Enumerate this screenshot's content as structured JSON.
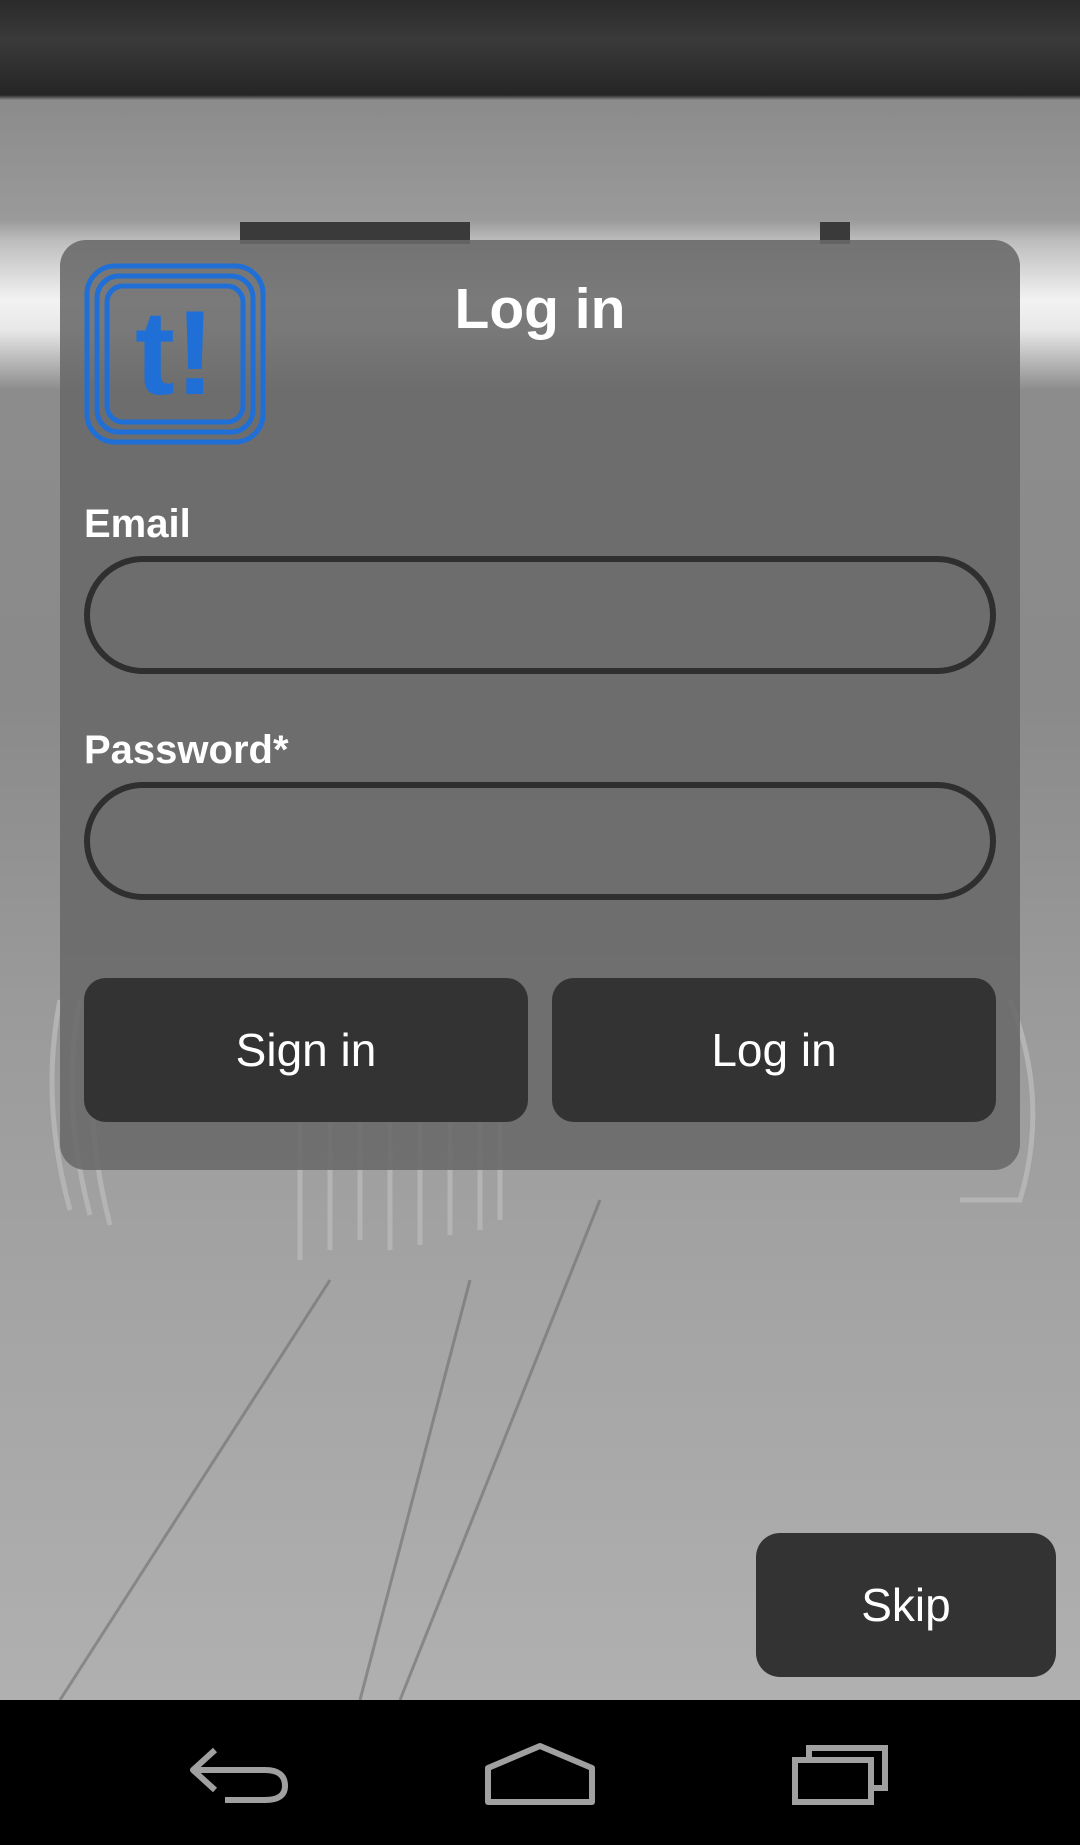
{
  "dialog": {
    "title": "Log in",
    "logo_text": "t!",
    "logo_color": "#1f6fd6"
  },
  "form": {
    "email_label": "Email",
    "email_value": "",
    "password_label": "Password*",
    "password_value": ""
  },
  "actions": {
    "signin_label": "Sign in",
    "login_label": "Log in",
    "skip_label": "Skip"
  },
  "navbar": {
    "back_icon": "back-icon",
    "home_icon": "home-icon",
    "recents_icon": "recents-icon"
  },
  "colors": {
    "card_bg": "#696969",
    "button_bg": "#333333",
    "input_border": "#2f2f2f",
    "text": "#ffffff",
    "navbar_bg": "#000000"
  }
}
